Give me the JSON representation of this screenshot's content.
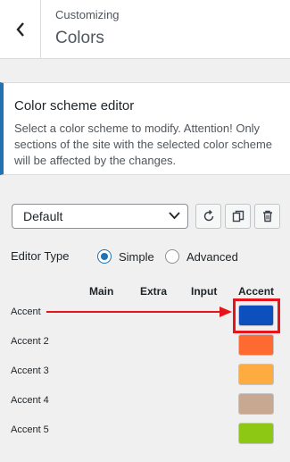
{
  "header": {
    "breadcrumb": "Customizing",
    "title": "Colors"
  },
  "section": {
    "title": "Color scheme editor",
    "description": "Select a color scheme to modify. Attention! Only sections of the site with the selected color scheme will be affected by the changes."
  },
  "scheme": {
    "selected": "Default"
  },
  "toolbar": {
    "icons": [
      "reset-icon",
      "copy-icon",
      "delete-icon"
    ]
  },
  "editor_type": {
    "label": "Editor Type",
    "options": [
      {
        "label": "Simple",
        "checked": true
      },
      {
        "label": "Advanced",
        "checked": false
      }
    ]
  },
  "columns": [
    "Main",
    "Extra",
    "Input",
    "Accent"
  ],
  "rows": [
    {
      "label": "Accent",
      "color": "#0d4fbd"
    },
    {
      "label": "Accent 2",
      "color": "#fe6a2f"
    },
    {
      "label": "Accent 3",
      "color": "#feab40"
    },
    {
      "label": "Accent 4",
      "color": "#c8a891"
    },
    {
      "label": "Accent 5",
      "color": "#8cc814"
    }
  ],
  "colors": {
    "highlight": "#e8141b",
    "primary": "#2271b1"
  }
}
